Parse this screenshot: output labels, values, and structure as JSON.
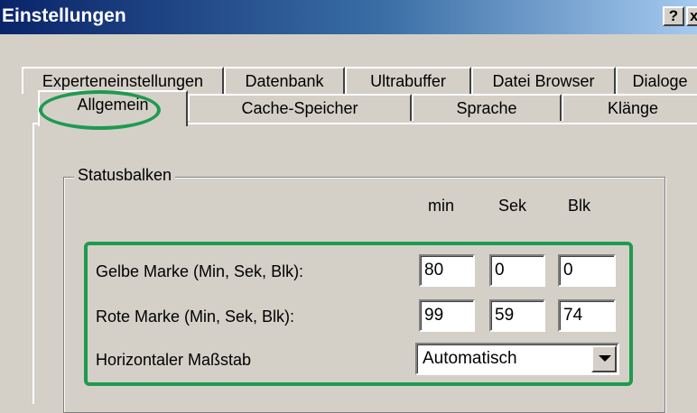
{
  "window": {
    "title": "Einstellungen",
    "help_button": "?",
    "close_button": "x"
  },
  "tabs": {
    "back_row": [
      "Experteneinstellungen",
      "Datenbank",
      "Ultrabuffer",
      "Datei Browser",
      "Dialoge"
    ],
    "front_row": [
      "Allgemein",
      "Cache-Speicher",
      "Sprache",
      "Klänge"
    ],
    "active": "Allgemein"
  },
  "statusbar_group": {
    "label": "Statusbalken",
    "columns": [
      "min",
      "Sek",
      "Blk"
    ],
    "rows": [
      {
        "label": "Gelbe Marke (Min, Sek, Blk):",
        "values": [
          "80",
          "0",
          "0"
        ]
      },
      {
        "label": "Rote Marke (Min, Sek, Blk):",
        "values": [
          "99",
          "59",
          "74"
        ]
      }
    ],
    "scale": {
      "label": "Horizontaler Maßstab",
      "selected": "Automatisch"
    }
  },
  "colors": {
    "highlight": "#1f9a4f",
    "title_gradient_start": "#0a246a",
    "title_gradient_end": "#a6caf0",
    "dialog_face": "#d4d0c8"
  },
  "icons": [
    "dropdown-arrow-icon"
  ]
}
